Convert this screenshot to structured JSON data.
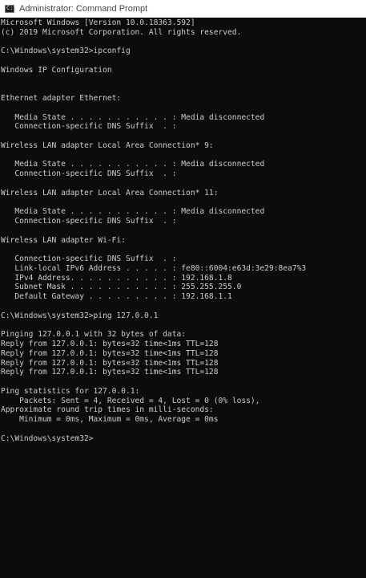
{
  "window": {
    "title": "Administrator: Command Prompt",
    "icon": "command-prompt-icon"
  },
  "colors": {
    "background": "#0c0c0c",
    "text": "#cccccc",
    "titlebar": "#ffffff"
  },
  "console": {
    "lines": [
      "Microsoft Windows [Version 10.0.18363.592]",
      "(c) 2019 Microsoft Corporation. All rights reserved.",
      "",
      "C:\\Windows\\system32>ipconfig",
      "",
      "Windows IP Configuration",
      "",
      "",
      "Ethernet adapter Ethernet:",
      "",
      "   Media State . . . . . . . . . . . : Media disconnected",
      "   Connection-specific DNS Suffix  . :",
      "",
      "Wireless LAN adapter Local Area Connection* 9:",
      "",
      "   Media State . . . . . . . . . . . : Media disconnected",
      "   Connection-specific DNS Suffix  . :",
      "",
      "Wireless LAN adapter Local Area Connection* 11:",
      "",
      "   Media State . . . . . . . . . . . : Media disconnected",
      "   Connection-specific DNS Suffix  . :",
      "",
      "Wireless LAN adapter Wi-Fi:",
      "",
      "   Connection-specific DNS Suffix  . :",
      "   Link-local IPv6 Address . . . . . : fe80::6004:e63d:3e29:8ea7%3",
      "   IPv4 Address. . . . . . . . . . . : 192.168.1.8",
      "   Subnet Mask . . . . . . . . . . . : 255.255.255.0",
      "   Default Gateway . . . . . . . . . : 192.168.1.1",
      "",
      "C:\\Windows\\system32>ping 127.0.0.1",
      "",
      "Pinging 127.0.0.1 with 32 bytes of data:",
      "Reply from 127.0.0.1: bytes=32 time<1ms TTL=128",
      "Reply from 127.0.0.1: bytes=32 time<1ms TTL=128",
      "Reply from 127.0.0.1: bytes=32 time<1ms TTL=128",
      "Reply from 127.0.0.1: bytes=32 time<1ms TTL=128",
      "",
      "Ping statistics for 127.0.0.1:",
      "    Packets: Sent = 4, Received = 4, Lost = 0 (0% loss),",
      "Approximate round trip times in milli-seconds:",
      "    Minimum = 0ms, Maximum = 0ms, Average = 0ms",
      "",
      "C:\\Windows\\system32>"
    ]
  }
}
